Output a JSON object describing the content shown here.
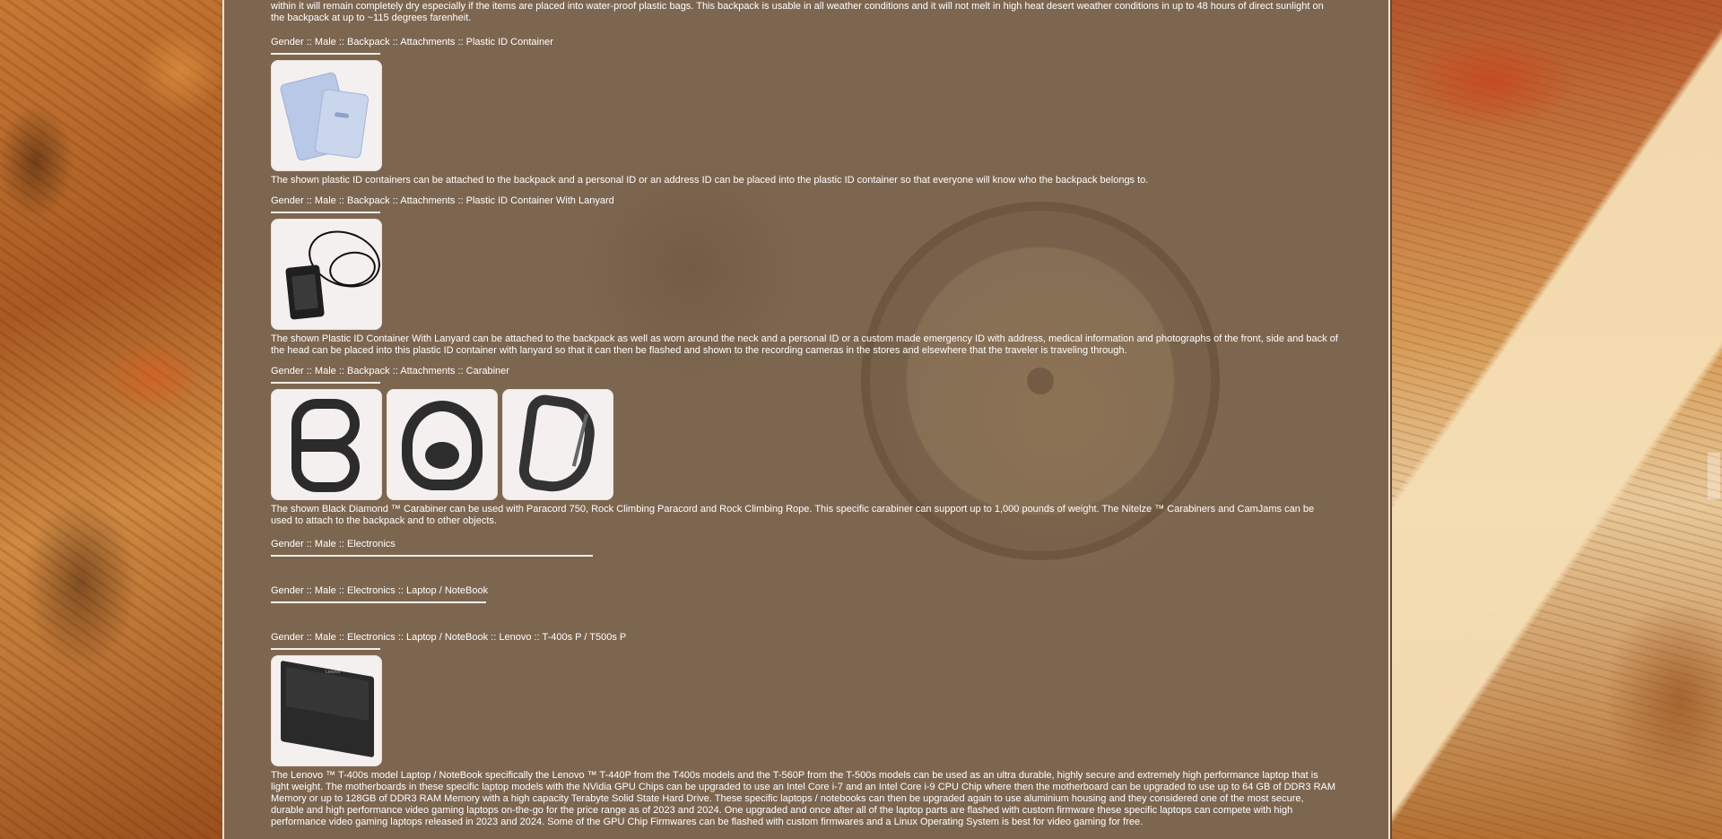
{
  "top_paragraph": "within it will remain completely dry especially if the items are placed into water-proof plastic bags. This backpack is usable in all weather conditions and it will not melt in high heat desert weather conditions in up to 48 hours of direct sunlight on the backpack at up to ~115 degrees farenheit.",
  "sections": [
    {
      "heading": "Gender :: Male :: Backpack :: Attachments :: Plastic ID Container",
      "images": [
        "plastic-id-container"
      ],
      "description": "The shown plastic ID containers can be attached to the backpack and a personal ID or an address ID can be placed into the plastic ID container so that everyone will know who the backpack belongs to."
    },
    {
      "heading": "Gender :: Male :: Backpack :: Attachments :: Plastic ID Container With Lanyard",
      "images": [
        "plastic-id-container-with-lanyard"
      ],
      "description": "The shown Plastic ID Container With Lanyard can be attached to the backpack as well as worn around the neck and a personal ID or a custom made emergency ID with address, medical information and photographs of the front, side and back of the head can be placed into this plastic ID container with lanyard so that it can then be flashed and shown to the recording cameras in the stores and elsewhere that the traveler is traveling through."
    },
    {
      "heading": "Gender :: Male :: Backpack :: Attachments :: Carabiner",
      "images": [
        "s-carabiner",
        "clip-carabiner",
        "black-diamond-carabiner"
      ],
      "description": "The shown Black Diamond ™ Carabiner can be used with Paracord 750, Rock Climbing Paracord and Rock Climbing Rope. This specific carabiner can support up to 1,000 pounds of weight. The Nitelze ™ Carabiners and CamJams can be used to attach to the backpack and to other objects."
    },
    {
      "heading": "Gender :: Male :: Electronics",
      "images": [],
      "description": ""
    },
    {
      "heading": "Gender :: Male :: Electronics :: Laptop / NoteBook",
      "images": [],
      "description": ""
    },
    {
      "heading": "Gender :: Male :: Electronics :: Laptop / NoteBook :: Lenovo :: T-400s P / T500s P",
      "images": [
        "lenovo-laptop"
      ],
      "description": "The Lenovo ™ T-400s model Laptop / NoteBook specifically the Lenovo ™ T-440P from the T400s models and the T-560P from the T-500s models can be used as an ultra durable, highly secure and extremely high performance laptop that is light weight. The motherboards in these specific laptop models with the NVidia GPU Chips can be upgraded to use an Intel Core i-7 and an Intel Core i-9 CPU Chip where then the motherboard can be upgraded to use up to 64 GB of DDR3 RAM Memory or up to 128GB of DDR3 RAM Memory with a high capacity Terabyte Solid State Hard Drive. These specific laptops / notebooks can then be upgraded again to use aluminium housing and they considered one of the most secure, durable and high performance video gaming laptops on-the-go for the price range as of 2023 and 2024. One upgraded and once after all of the laptop parts are flashed with custom firmware these specific laptops can compete with high performance video gaming laptops released in 2023 and 2024. Some of the GPU Chip Firmwares can be flashed with custom firmwares and a Linux Operating System is best for video gaming for free."
    }
  ],
  "laptop_brand_mark": "Lenovo"
}
